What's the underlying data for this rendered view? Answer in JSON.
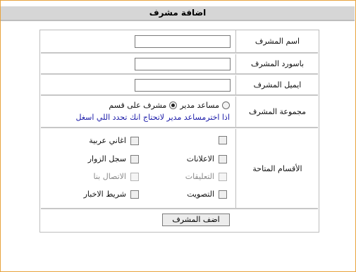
{
  "page": {
    "title": "اضافة مشرف"
  },
  "form": {
    "name_label": "اسم المشرف",
    "password_label": "باسورد المشرف",
    "email_label": "ايميل المشرف",
    "group_label": "مجموعة المشرف",
    "group_options": [
      {
        "label": "مساعد مدير",
        "selected": false
      },
      {
        "label": "مشرف على قسم",
        "selected": true
      }
    ],
    "group_hint": "اذا اخترمساعد مدير لاتحتاج انك تحدد اللي اسغل",
    "sections_label": "الأقسام المتاحة",
    "sections": [
      {
        "label": "",
        "checked": false,
        "enabled": true
      },
      {
        "label": "اغاني عربية",
        "checked": false,
        "enabled": true
      },
      {
        "label": "الاعلانات",
        "checked": false,
        "enabled": true
      },
      {
        "label": "سجل الزوار",
        "checked": false,
        "enabled": true
      },
      {
        "label": "التعليقات",
        "checked": false,
        "enabled": false
      },
      {
        "label": "الاتصال بنا",
        "checked": false,
        "enabled": false
      },
      {
        "label": "التصويت",
        "checked": false,
        "enabled": true
      },
      {
        "label": "شريط الاخبار",
        "checked": false,
        "enabled": true
      }
    ],
    "submit_label": "اضف المشرف"
  }
}
